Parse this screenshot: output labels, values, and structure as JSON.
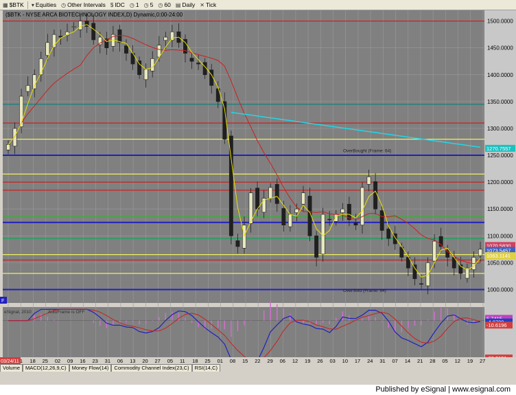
{
  "toolbar": {
    "symbol": "$BTK",
    "equities": "Equities",
    "other_intervals": "Other Intervals",
    "idc": "IDC",
    "i1": "1",
    "i5": "5",
    "i60": "60",
    "daily": "Daily",
    "tick": "Tick"
  },
  "chart_title": "($BTK - NYSE ARCA BIOTECHNOLOGY INDEX,D) Dynamic,0:00-24:00",
  "colors": {
    "background": "#808080",
    "up_candle": "#e8e8c0",
    "down_candle": "#202020",
    "ma_red": "#cc2020",
    "ma_yellow": "#e8e000",
    "cyan": "#20d8e8",
    "macd_blue": "#2020c0",
    "histogram": "#d070d0"
  },
  "chart_data": {
    "type": "candlestick",
    "price_axis": {
      "ylim": [
        975,
        1520
      ],
      "ticks": [
        1000,
        1050,
        1100,
        1150,
        1200,
        1250,
        1300,
        1350,
        1400,
        1450,
        1500
      ]
    },
    "tick_labels_y": [
      "1000.0000",
      "1050.0000",
      "1100.0000",
      "1150.0000",
      "1200.0000",
      "1250.0000",
      "1300.0000",
      "1350.0000",
      "1400.0000",
      "1450.0000",
      "1500.0000"
    ],
    "x_dates": [
      "04",
      "11",
      "18",
      "25",
      "02",
      "09",
      "16",
      "23",
      "31",
      "06",
      "13",
      "20",
      "27",
      "05",
      "11",
      "18",
      "25",
      "01",
      "08",
      "15",
      "22",
      "29",
      "06",
      "12",
      "19",
      "26",
      "03",
      "10",
      "17",
      "24",
      "31",
      "07",
      "14",
      "21",
      "28",
      "05",
      "12",
      "19",
      "27"
    ],
    "month_labels": [
      {
        "label": "Apr",
        "at": 0
      },
      {
        "label": "May",
        "at": 4
      },
      {
        "label": "Jun",
        "at": 9
      },
      {
        "label": "Jul",
        "at": 13
      },
      {
        "label": "Aug",
        "at": 17
      },
      {
        "label": "Sep",
        "at": 22
      },
      {
        "label": "Oct",
        "at": 26
      },
      {
        "label": "Nov",
        "at": 31
      },
      {
        "label": "Dec",
        "at": 35
      }
    ],
    "first_date_tag": "03/24/11",
    "horizontal_levels": [
      {
        "value": 1500,
        "color": "#cc2020"
      },
      {
        "value": 1310,
        "color": "#cc2020"
      },
      {
        "value": 1345,
        "color": "#208080"
      },
      {
        "value": 1280,
        "color": "#f0f060"
      },
      {
        "value": 1250,
        "color": "#2020c0"
      },
      {
        "value": 1215,
        "color": "#f0f060"
      },
      {
        "value": 1200,
        "color": "#cc2020"
      },
      {
        "value": 1185,
        "color": "#cc2020"
      },
      {
        "value": 1135,
        "color": "#20c020"
      },
      {
        "value": 1125,
        "color": "#2020c0"
      },
      {
        "value": 1095,
        "color": "#20a060"
      },
      {
        "value": 1065,
        "color": "#f0f060"
      },
      {
        "value": 1055,
        "color": "#cc2020"
      },
      {
        "value": 1030,
        "color": "#f0f060"
      },
      {
        "value": 1000,
        "color": "#2020c0"
      }
    ],
    "annotations": [
      {
        "text": "OverBought (Frame: 64)",
        "value": 1253
      },
      {
        "text": "OverSold (Frame: 64)",
        "value": 993
      }
    ],
    "price_tags": [
      {
        "text": "1270.7557",
        "value": 1263,
        "bg": "#20c0c0"
      },
      {
        "text": "1070.5830",
        "value": 1082,
        "bg": "#d04060"
      },
      {
        "text": "1073.5457",
        "value": 1073,
        "bg": "#4060c0"
      },
      {
        "text": "1063.1141",
        "value": 1063,
        "bg": "#e0d040"
      }
    ],
    "closes": [
      1270,
      1300,
      1360,
      1380,
      1400,
      1430,
      1460,
      1475,
      1470,
      1480,
      1490,
      1500,
      1490,
      1465,
      1470,
      1450,
      1475,
      1460,
      1440,
      1420,
      1400,
      1410,
      1430,
      1455,
      1470,
      1480,
      1460,
      1440,
      1425,
      1420,
      1400,
      1380,
      1350,
      1280,
      1100,
      1080,
      1120,
      1180,
      1150,
      1170,
      1190,
      1160,
      1120,
      1140,
      1150,
      1180,
      1100,
      1060,
      1140,
      1130,
      1140,
      1150,
      1130,
      1120,
      1190,
      1210,
      1150,
      1110,
      1095,
      1085,
      1060,
      1040,
      1020,
      1010,
      1050,
      1090,
      1080,
      1060,
      1040,
      1030,
      1040,
      1060,
      1075
    ],
    "macd_axis": {
      "ylim": [
        -95,
        30
      ]
    },
    "macd_tags": [
      {
        "text": "5.7415",
        "value": 5,
        "bg": "#c040c0"
      },
      {
        "text": "-4.8709",
        "value": -3,
        "bg": "#2040c0"
      },
      {
        "text": "-10.6196",
        "value": -10,
        "bg": "#d04040"
      },
      {
        "text": "-83.0151",
        "value": -83,
        "bg": "#d04040"
      }
    ],
    "macd_labels": [
      "eSignal, 2010",
      "AutoFrame is OFF"
    ]
  },
  "tabs": [
    "Volume",
    "MACD(12,26,9,C)",
    "Money Flow(14)",
    "Commodity Channel Index(23,C)",
    "RSI(14,C)"
  ],
  "footer": "Published by eSignal | www.esignal.com"
}
